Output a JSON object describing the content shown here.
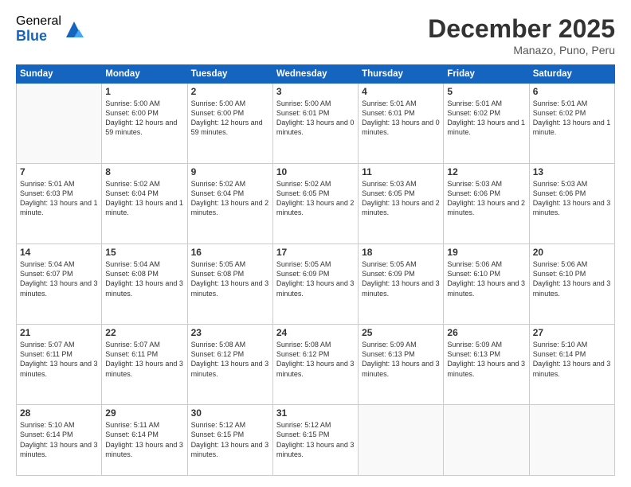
{
  "logo": {
    "general": "General",
    "blue": "Blue"
  },
  "title": "December 2025",
  "location": "Manazo, Puno, Peru",
  "days": [
    "Sunday",
    "Monday",
    "Tuesday",
    "Wednesday",
    "Thursday",
    "Friday",
    "Saturday"
  ],
  "weeks": [
    [
      {
        "num": "",
        "empty": true
      },
      {
        "num": "1",
        "sunrise": "5:00 AM",
        "sunset": "6:00 PM",
        "daylight": "12 hours and 59 minutes."
      },
      {
        "num": "2",
        "sunrise": "5:00 AM",
        "sunset": "6:00 PM",
        "daylight": "12 hours and 59 minutes."
      },
      {
        "num": "3",
        "sunrise": "5:00 AM",
        "sunset": "6:01 PM",
        "daylight": "13 hours and 0 minutes."
      },
      {
        "num": "4",
        "sunrise": "5:01 AM",
        "sunset": "6:01 PM",
        "daylight": "13 hours and 0 minutes."
      },
      {
        "num": "5",
        "sunrise": "5:01 AM",
        "sunset": "6:02 PM",
        "daylight": "13 hours and 1 minute."
      },
      {
        "num": "6",
        "sunrise": "5:01 AM",
        "sunset": "6:02 PM",
        "daylight": "13 hours and 1 minute."
      }
    ],
    [
      {
        "num": "7",
        "sunrise": "5:01 AM",
        "sunset": "6:03 PM",
        "daylight": "13 hours and 1 minute."
      },
      {
        "num": "8",
        "sunrise": "5:02 AM",
        "sunset": "6:04 PM",
        "daylight": "13 hours and 1 minute."
      },
      {
        "num": "9",
        "sunrise": "5:02 AM",
        "sunset": "6:04 PM",
        "daylight": "13 hours and 2 minutes."
      },
      {
        "num": "10",
        "sunrise": "5:02 AM",
        "sunset": "6:05 PM",
        "daylight": "13 hours and 2 minutes."
      },
      {
        "num": "11",
        "sunrise": "5:03 AM",
        "sunset": "6:05 PM",
        "daylight": "13 hours and 2 minutes."
      },
      {
        "num": "12",
        "sunrise": "5:03 AM",
        "sunset": "6:06 PM",
        "daylight": "13 hours and 2 minutes."
      },
      {
        "num": "13",
        "sunrise": "5:03 AM",
        "sunset": "6:06 PM",
        "daylight": "13 hours and 3 minutes."
      }
    ],
    [
      {
        "num": "14",
        "sunrise": "5:04 AM",
        "sunset": "6:07 PM",
        "daylight": "13 hours and 3 minutes."
      },
      {
        "num": "15",
        "sunrise": "5:04 AM",
        "sunset": "6:08 PM",
        "daylight": "13 hours and 3 minutes."
      },
      {
        "num": "16",
        "sunrise": "5:05 AM",
        "sunset": "6:08 PM",
        "daylight": "13 hours and 3 minutes."
      },
      {
        "num": "17",
        "sunrise": "5:05 AM",
        "sunset": "6:09 PM",
        "daylight": "13 hours and 3 minutes."
      },
      {
        "num": "18",
        "sunrise": "5:05 AM",
        "sunset": "6:09 PM",
        "daylight": "13 hours and 3 minutes."
      },
      {
        "num": "19",
        "sunrise": "5:06 AM",
        "sunset": "6:10 PM",
        "daylight": "13 hours and 3 minutes."
      },
      {
        "num": "20",
        "sunrise": "5:06 AM",
        "sunset": "6:10 PM",
        "daylight": "13 hours and 3 minutes."
      }
    ],
    [
      {
        "num": "21",
        "sunrise": "5:07 AM",
        "sunset": "6:11 PM",
        "daylight": "13 hours and 3 minutes."
      },
      {
        "num": "22",
        "sunrise": "5:07 AM",
        "sunset": "6:11 PM",
        "daylight": "13 hours and 3 minutes."
      },
      {
        "num": "23",
        "sunrise": "5:08 AM",
        "sunset": "6:12 PM",
        "daylight": "13 hours and 3 minutes."
      },
      {
        "num": "24",
        "sunrise": "5:08 AM",
        "sunset": "6:12 PM",
        "daylight": "13 hours and 3 minutes."
      },
      {
        "num": "25",
        "sunrise": "5:09 AM",
        "sunset": "6:13 PM",
        "daylight": "13 hours and 3 minutes."
      },
      {
        "num": "26",
        "sunrise": "5:09 AM",
        "sunset": "6:13 PM",
        "daylight": "13 hours and 3 minutes."
      },
      {
        "num": "27",
        "sunrise": "5:10 AM",
        "sunset": "6:14 PM",
        "daylight": "13 hours and 3 minutes."
      }
    ],
    [
      {
        "num": "28",
        "sunrise": "5:10 AM",
        "sunset": "6:14 PM",
        "daylight": "13 hours and 3 minutes."
      },
      {
        "num": "29",
        "sunrise": "5:11 AM",
        "sunset": "6:14 PM",
        "daylight": "13 hours and 3 minutes."
      },
      {
        "num": "30",
        "sunrise": "5:12 AM",
        "sunset": "6:15 PM",
        "daylight": "13 hours and 3 minutes."
      },
      {
        "num": "31",
        "sunrise": "5:12 AM",
        "sunset": "6:15 PM",
        "daylight": "13 hours and 3 minutes."
      },
      {
        "num": "",
        "empty": true
      },
      {
        "num": "",
        "empty": true
      },
      {
        "num": "",
        "empty": true
      }
    ]
  ]
}
